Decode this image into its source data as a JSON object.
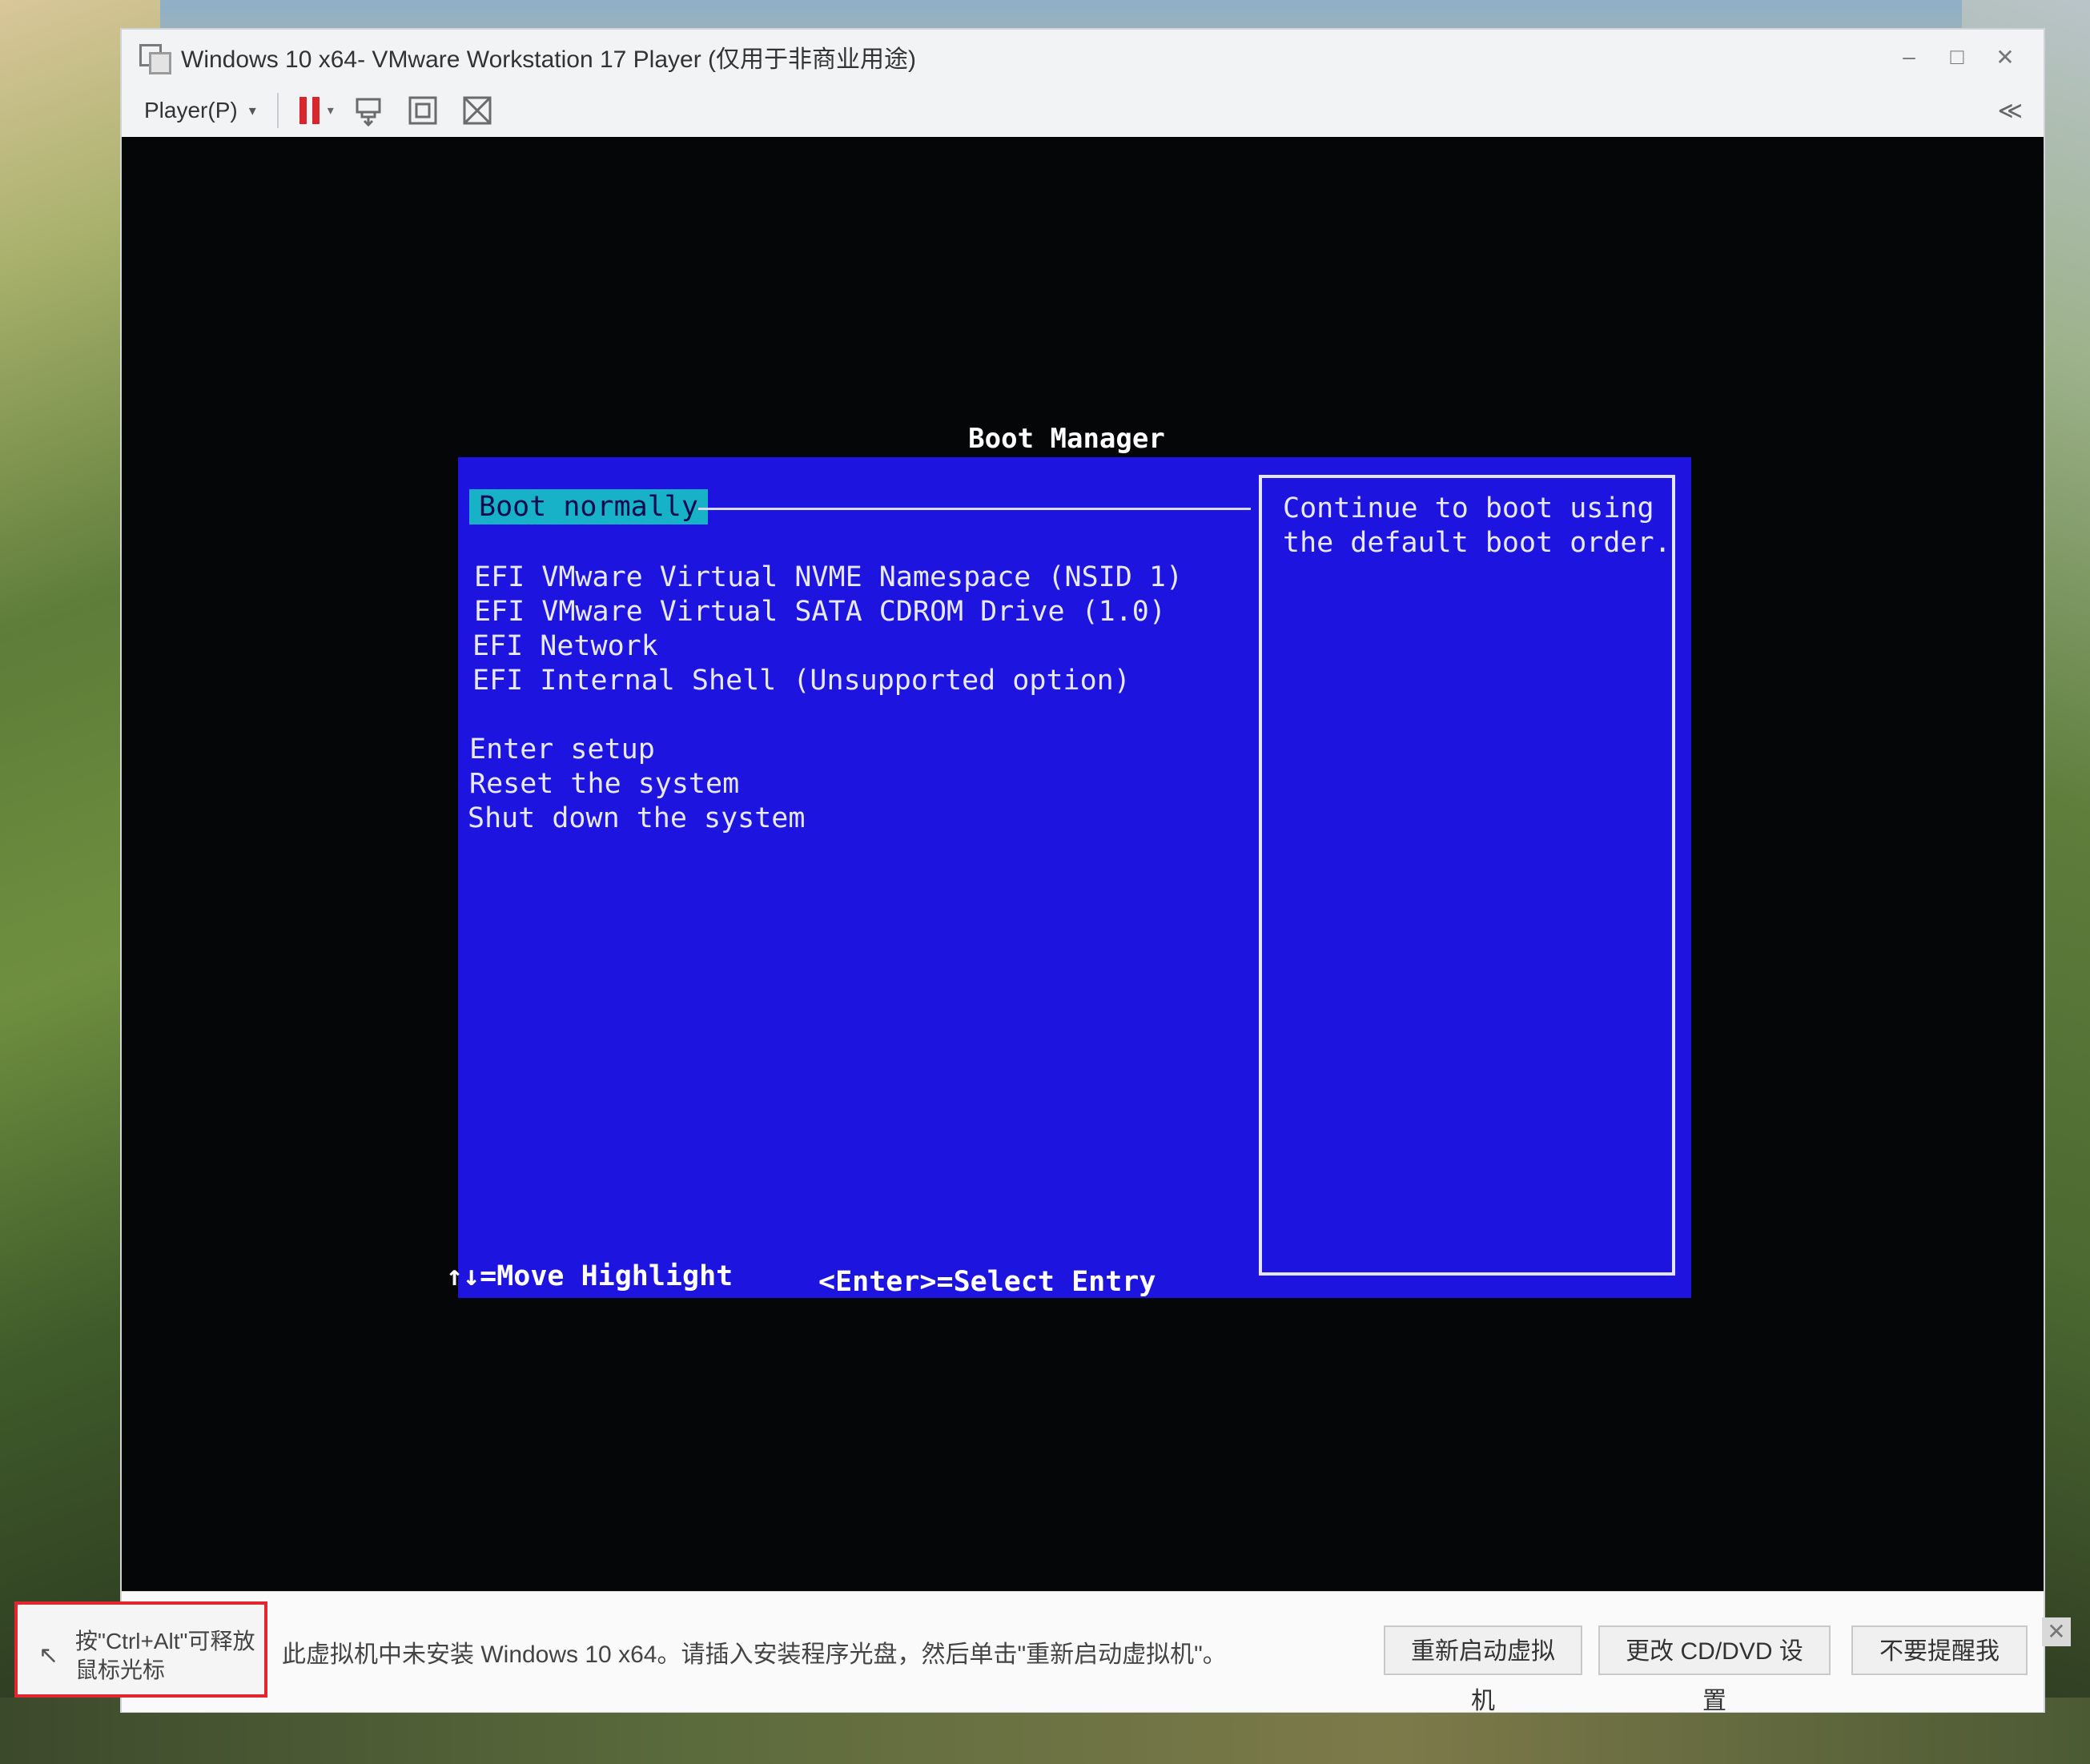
{
  "window": {
    "title": "Windows 10 x64- VMware Workstation 17 Player (仅用于非商业用途)",
    "controls": {
      "minimize": "–",
      "maximize": "□",
      "close": "✕"
    }
  },
  "toolbar": {
    "player_menu": "Player(P)",
    "dropdown_arrow": "▾",
    "collapse": "≪",
    "icons": [
      "pause-icon",
      "send-ctrl-alt-del-icon",
      "fit-screen-icon",
      "unity-icon"
    ]
  },
  "boot_manager": {
    "title": "Boot Manager",
    "items": [
      "Boot normally",
      "EFI VMware Virtual NVME Namespace (NSID 1)",
      "EFI VMware Virtual SATA CDROM Drive (1.0)",
      "EFI Network",
      "EFI Internal Shell (Unsupported option)",
      "Enter setup",
      "Reset the system",
      "Shut down the system"
    ],
    "help_lines": [
      "Continue to boot using",
      "the default boot order."
    ],
    "footer_move": "↑↓=Move Highlight",
    "footer_select": "<Enter>=Select Entry"
  },
  "notice_bar": {
    "hint": "按\"Ctrl+Alt\"可释放鼠标光标",
    "message": "此虚拟机中未安装 Windows 10 x64。请插入安装程序光盘，然后单击\"重新启动虚拟机\"。",
    "restart_button": "重新启动虚拟机",
    "change_cd_button": "更改 CD/DVD 设置",
    "dismiss_button": "不要提醒我",
    "close": "✕"
  },
  "colors": {
    "bios_blue": "#1d14e0",
    "highlight_cyan": "#18b2c8",
    "pause_red": "#d9262c",
    "hint_border_red": "#e2262f"
  }
}
